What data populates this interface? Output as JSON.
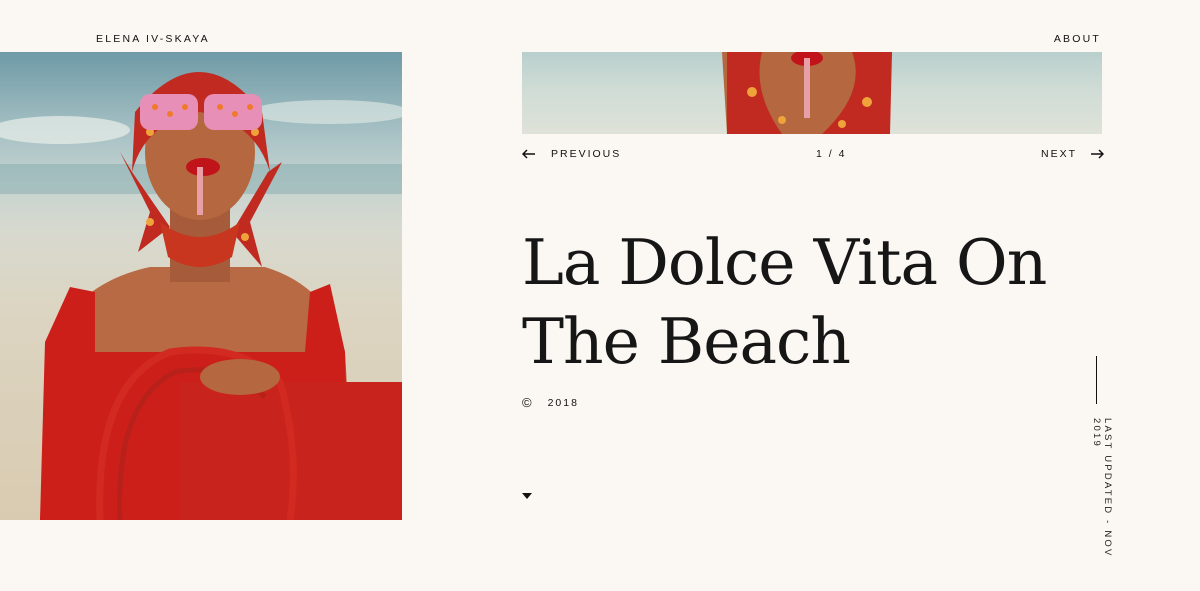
{
  "header": {
    "brand": "ELENA IV-SKAYA",
    "about": "ABOUT"
  },
  "gallery": {
    "previous_label": "PREVIOUS",
    "counter": "1 / 4",
    "next_label": "NEXT",
    "current": 1,
    "total": 4
  },
  "project": {
    "title_line1": "La Dolce Vita On",
    "title_line2": "The Beach",
    "copyright_symbol": "©",
    "year": "2018"
  },
  "sidebar": {
    "last_updated": "LAST UPDATED - NOV 2019"
  },
  "icons": {
    "prev": "arrow-left-icon",
    "next": "arrow-right-icon",
    "scroll": "caret-down-icon"
  },
  "colors": {
    "background": "#fbf8f3",
    "text": "#111111",
    "accent_red": "#c8231c"
  }
}
